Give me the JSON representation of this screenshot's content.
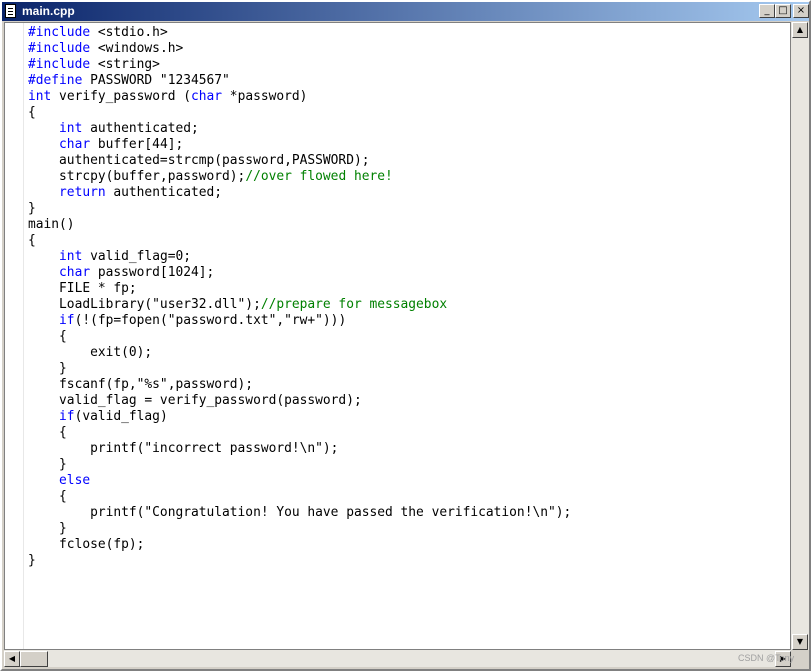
{
  "window": {
    "title": "main.cpp",
    "min_label": "_",
    "max_label": "□",
    "close_label": "×"
  },
  "colors": {
    "keyword": "#0000ff",
    "comment": "#008000",
    "text": "#000000",
    "titlebar": "#0a246a"
  },
  "code_lines": [
    [
      {
        "t": "#include",
        "c": "kw"
      },
      {
        "t": " <stdio.h>"
      }
    ],
    [
      {
        "t": "#include",
        "c": "kw"
      },
      {
        "t": " <windows.h>"
      }
    ],
    [
      {
        "t": "#include",
        "c": "kw"
      },
      {
        "t": " <string>"
      }
    ],
    [
      {
        "t": "#define",
        "c": "kw"
      },
      {
        "t": " PASSWORD \"1234567\""
      }
    ],
    [
      {
        "t": "int",
        "c": "kw"
      },
      {
        "t": " verify_password ("
      },
      {
        "t": "char",
        "c": "kw"
      },
      {
        "t": " *password)"
      }
    ],
    [
      {
        "t": "{"
      }
    ],
    [
      {
        "t": "    "
      },
      {
        "t": "int",
        "c": "kw"
      },
      {
        "t": " authenticated;"
      }
    ],
    [
      {
        "t": "    "
      },
      {
        "t": "char",
        "c": "kw"
      },
      {
        "t": " buffer[44];"
      }
    ],
    [
      {
        "t": "    authenticated=strcmp(password,PASSWORD);"
      }
    ],
    [
      {
        "t": "    strcpy(buffer,password);"
      },
      {
        "t": "//over flowed here!",
        "c": "cm"
      }
    ],
    [
      {
        "t": "    "
      },
      {
        "t": "return",
        "c": "kw"
      },
      {
        "t": " authenticated;"
      }
    ],
    [
      {
        "t": "}"
      }
    ],
    [
      {
        "t": "main()"
      }
    ],
    [
      {
        "t": "{"
      }
    ],
    [
      {
        "t": "    "
      },
      {
        "t": "int",
        "c": "kw"
      },
      {
        "t": " valid_flag=0;"
      }
    ],
    [
      {
        "t": "    "
      },
      {
        "t": "char",
        "c": "kw"
      },
      {
        "t": " password[1024];"
      }
    ],
    [
      {
        "t": "    FILE * fp;"
      }
    ],
    [
      {
        "t": "    LoadLibrary(\"user32.dll\");"
      },
      {
        "t": "//prepare for messagebox",
        "c": "cm"
      }
    ],
    [
      {
        "t": "    "
      },
      {
        "t": "if",
        "c": "kw"
      },
      {
        "t": "(!(fp=fopen(\"password.txt\",\"rw+\")))"
      }
    ],
    [
      {
        "t": "    {"
      }
    ],
    [
      {
        "t": "        exit(0);"
      }
    ],
    [
      {
        "t": "    }"
      }
    ],
    [
      {
        "t": "    fscanf(fp,\"%s\",password);"
      }
    ],
    [
      {
        "t": "    valid_flag = verify_password(password);"
      }
    ],
    [
      {
        "t": "    "
      },
      {
        "t": "if",
        "c": "kw"
      },
      {
        "t": "(valid_flag)"
      }
    ],
    [
      {
        "t": "    {"
      }
    ],
    [
      {
        "t": "        printf(\"incorrect password!\\n\");"
      }
    ],
    [
      {
        "t": "    }"
      }
    ],
    [
      {
        "t": "    "
      },
      {
        "t": "else",
        "c": "kw"
      }
    ],
    [
      {
        "t": "    {"
      }
    ],
    [
      {
        "t": "        printf(\"Congratulation! You have passed the verification!\\n\");"
      }
    ],
    [
      {
        "t": "    }"
      }
    ],
    [
      {
        "t": "    fclose(fp);"
      }
    ],
    [
      {
        "t": "}"
      }
    ]
  ],
  "scrollbars": {
    "up_arrow": "▲",
    "down_arrow": "▼",
    "left_arrow": "◀",
    "right_arrow": "▶"
  },
  "watermark": "CSDN @Tony"
}
